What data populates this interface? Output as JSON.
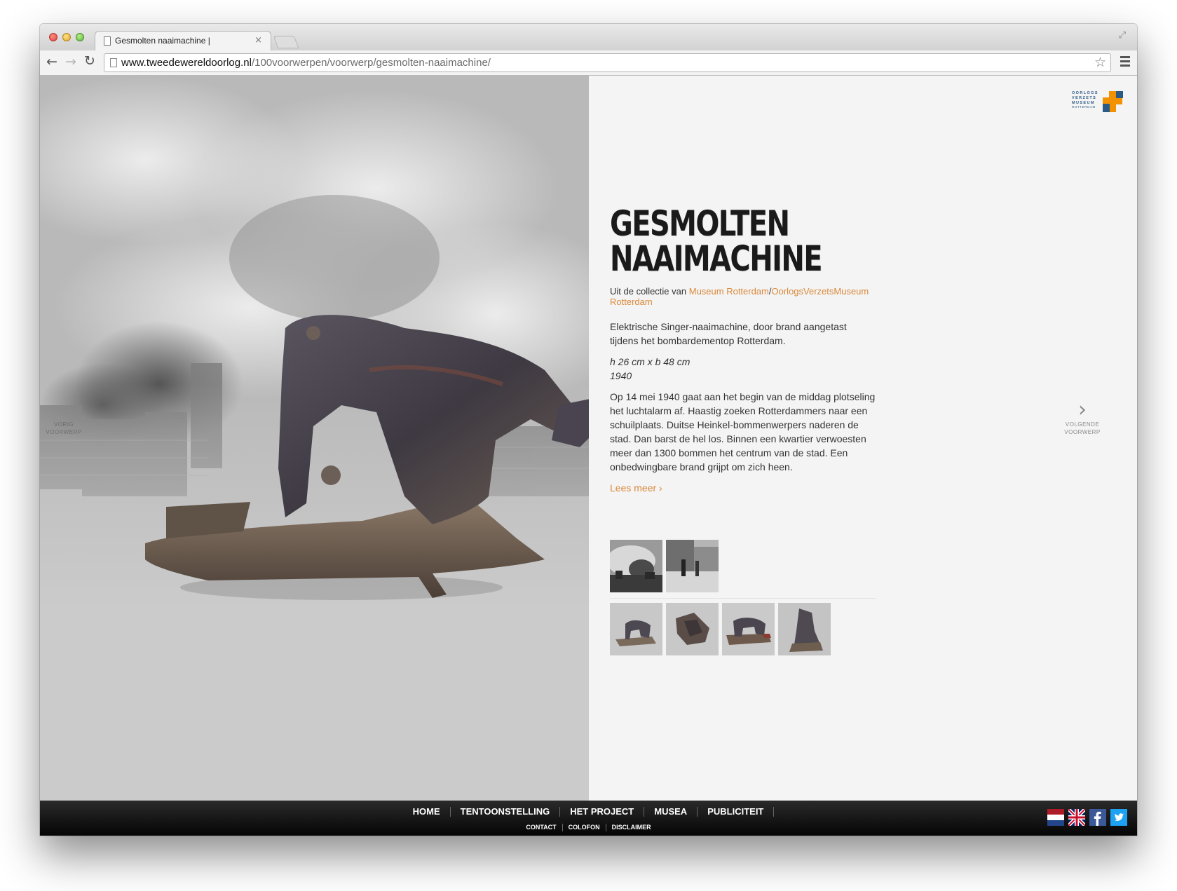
{
  "browser": {
    "tab_title": "Gesmolten naaimachine | ",
    "tab_close": "×",
    "url_host": "www.tweedewereldoorlog.nl",
    "url_path": "/100voorwerpen/voorwerp/gesmolten-naaimachine/"
  },
  "logo": {
    "lines": [
      "OORLOGS",
      "VERZETS",
      "MUSEUM",
      "ROTTERDAM"
    ],
    "colors": {
      "orange": "#f39200",
      "blue": "#2c5a86"
    }
  },
  "nav": {
    "prev_label_1": "VORIG",
    "prev_label_2": "VOORWERP",
    "next_label_1": "VOLGENDE",
    "next_label_2": "VOORWERP"
  },
  "object": {
    "title_line1": "GESMOLTEN",
    "title_line2": "NAAIMACHINE",
    "collection_prefix": "Uit de collectie van ",
    "collection_link1": "Museum Rotterdam",
    "collection_sep": "/",
    "collection_link2": "OorlogsVerzetsMuseum Rotterdam",
    "description": "Elektrische Singer-naaimachine, door brand aangetast tijdens het bombardementop Rotterdam.",
    "dimensions": "h 26 cm x b 48 cm",
    "year": "1940",
    "story": "Op 14 mei 1940 gaat aan het begin van de middag plotseling het luchtalarm af. Haastig zoeken Rotterdammers naar een schuilplaats. Duitse Heinkel-bommenwerpers naderen de stad. Dan barst de hel los. Binnen een kwartier verwoesten meer dan 1300 bommen het centrum van de stad. Een onbedwingbare brand grijpt om zich heen.",
    "read_more": "Lees meer ›",
    "accent_color": "#d9893a"
  },
  "footer": {
    "main_links": [
      "HOME",
      "TENTOONSTELLING",
      "HET PROJECT",
      "MUSEA",
      "PUBLICITEIT"
    ],
    "sub_links": [
      "CONTACT",
      "COLOFON",
      "DISCLAIMER"
    ]
  }
}
